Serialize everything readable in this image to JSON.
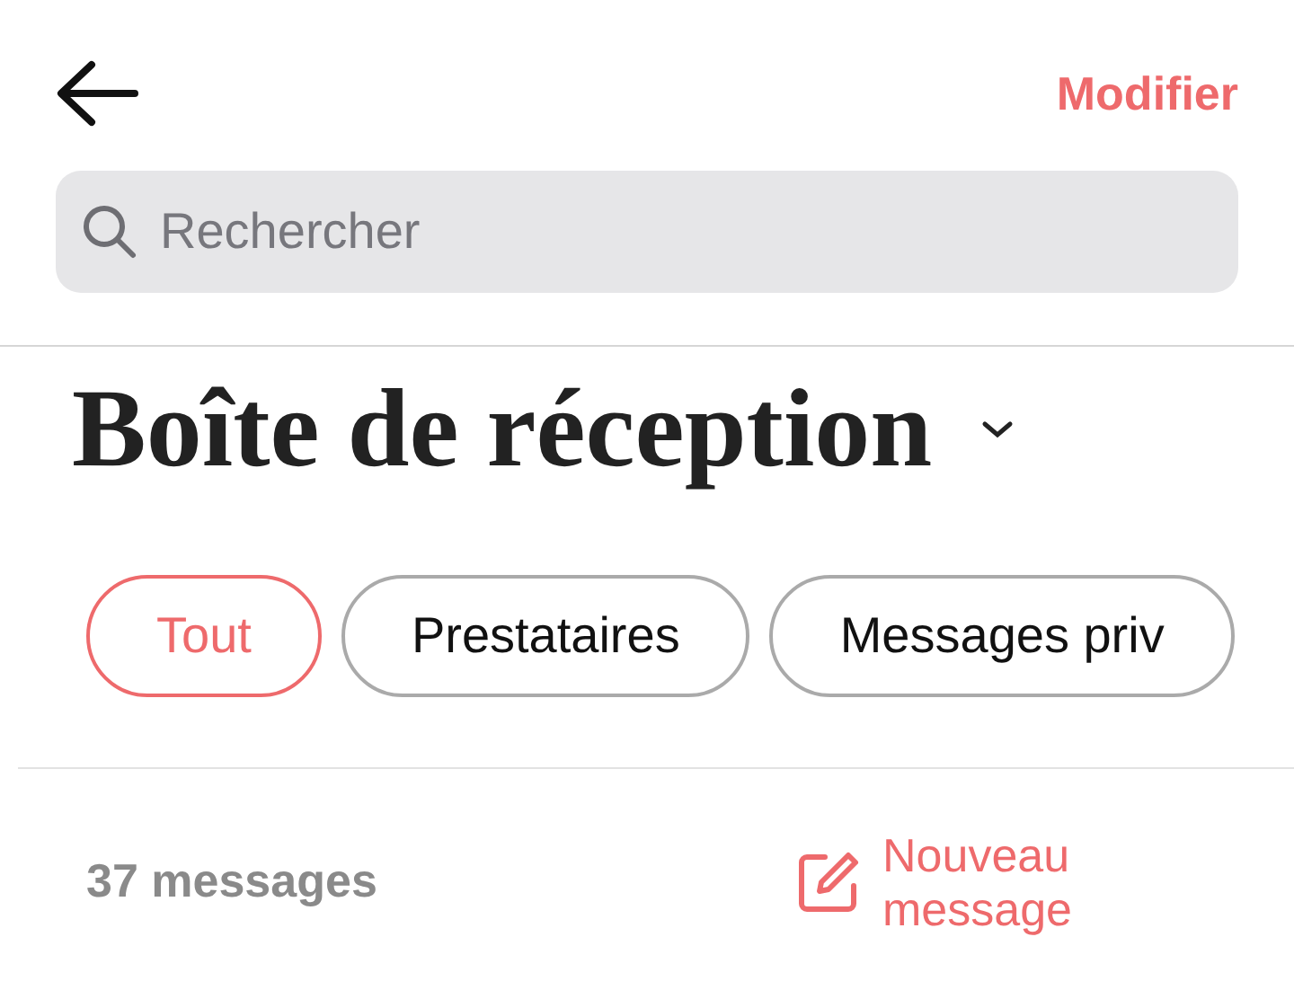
{
  "header": {
    "edit_link": "Modifier"
  },
  "search": {
    "placeholder": "Rechercher"
  },
  "title": "Boîte de réception",
  "filters": [
    {
      "label": "Tout",
      "selected": true
    },
    {
      "label": "Prestataires",
      "selected": false
    },
    {
      "label": "Messages priv",
      "selected": false
    }
  ],
  "footer": {
    "message_count": "37 messages",
    "new_message_button": "Nouveau message"
  }
}
